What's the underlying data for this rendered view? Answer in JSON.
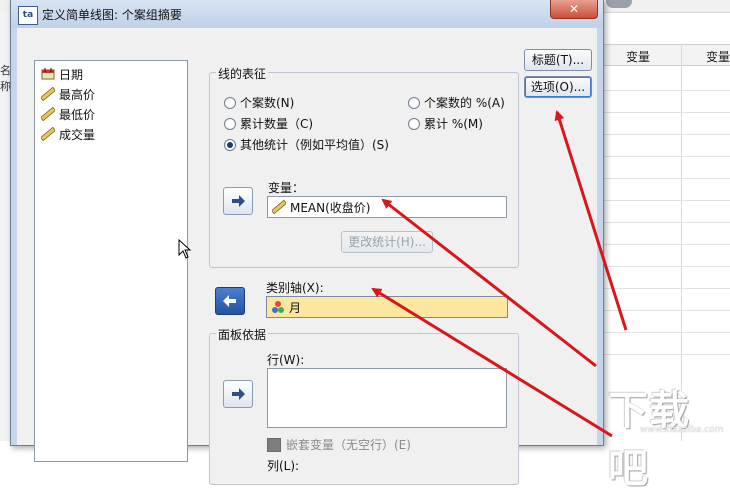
{
  "background": {
    "columns": [
      "变量",
      "变量"
    ],
    "left_label": "名称"
  },
  "watermark": {
    "text": "下载吧",
    "url": "www.xiazaiba.com"
  },
  "dialog": {
    "title": "定义简单线图: 个案组摘要",
    "app_icon": "ta",
    "close_glyph": "✕",
    "variables": [
      {
        "label": "日期",
        "icon": "date-scale-icon"
      },
      {
        "label": "最高价",
        "icon": "scale-ruler-icon"
      },
      {
        "label": "最低价",
        "icon": "scale-ruler-icon"
      },
      {
        "label": "成交量",
        "icon": "scale-ruler-icon"
      }
    ],
    "line_group": {
      "title": "线的表征",
      "options": {
        "n_cases": "个案数(N)",
        "cum_n": "累计数量（C)",
        "other_stat": "其他统计（例如平均值）(S)",
        "pct_cases": "个案数的 %(A)",
        "cum_pct": "累计 %(M)"
      },
      "selected": "other_stat",
      "variable_label": "变量：",
      "variable_value": "MEAN(收盘价)",
      "change_stat_button": "更改统计(H)..."
    },
    "category_axis": {
      "label": "类别轴(X):",
      "value": "月"
    },
    "panel_group": {
      "title": "面板依据",
      "row_label": "行(W):",
      "nest_checkbox": "嵌套变量（无空行）(E)",
      "col_label": "列(L):"
    },
    "side_buttons": {
      "titles": "标题(T)...",
      "options": "选项(O)..."
    }
  },
  "colors": {
    "annotation_arrow": "#d9161c",
    "selected_field": "#fbe7a0",
    "titlebar": "#c6d6ea"
  }
}
